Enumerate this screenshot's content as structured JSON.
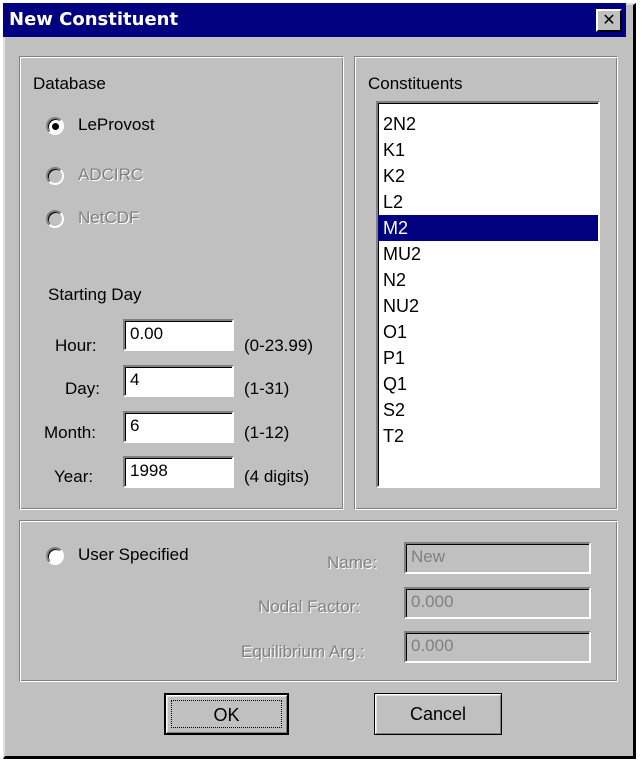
{
  "window": {
    "title": "New Constituent",
    "close_glyph": "✕"
  },
  "database": {
    "title": "Database",
    "options": [
      {
        "label": "LeProvost",
        "checked": true,
        "enabled": true
      },
      {
        "label": "ADCIRC",
        "checked": false,
        "enabled": false
      },
      {
        "label": "NetCDF",
        "checked": false,
        "enabled": false
      }
    ]
  },
  "starting_day": {
    "title": "Starting Day",
    "fields": [
      {
        "label": "Hour:",
        "value": "0.00",
        "range": "(0-23.99)"
      },
      {
        "label": "Day:",
        "value": "4",
        "range": "(1-31)"
      },
      {
        "label": "Month:",
        "value": "6",
        "range": "(1-12)"
      },
      {
        "label": "Year:",
        "value": "1998",
        "range": "(4 digits)"
      }
    ]
  },
  "constituents": {
    "title": "Constituents",
    "items": [
      "2N2",
      "K1",
      "K2",
      "L2",
      "M2",
      "MU2",
      "N2",
      "NU2",
      "O1",
      "P1",
      "Q1",
      "S2",
      "T2"
    ],
    "selected": "M2"
  },
  "user_specified": {
    "label": "User Specified",
    "checked": false,
    "name_label": "Name:",
    "name_value": "New",
    "nodal_label": "Nodal Factor:",
    "nodal_value": "0.000",
    "equilibrium_label": "Equilibrium Arg.:",
    "equilibrium_value": "0.000"
  },
  "buttons": {
    "ok": "OK",
    "cancel": "Cancel"
  },
  "colors": {
    "titlebar": "#000080",
    "face": "#c0c0c0",
    "selection": "#000080",
    "disabled_text": "#808080"
  }
}
